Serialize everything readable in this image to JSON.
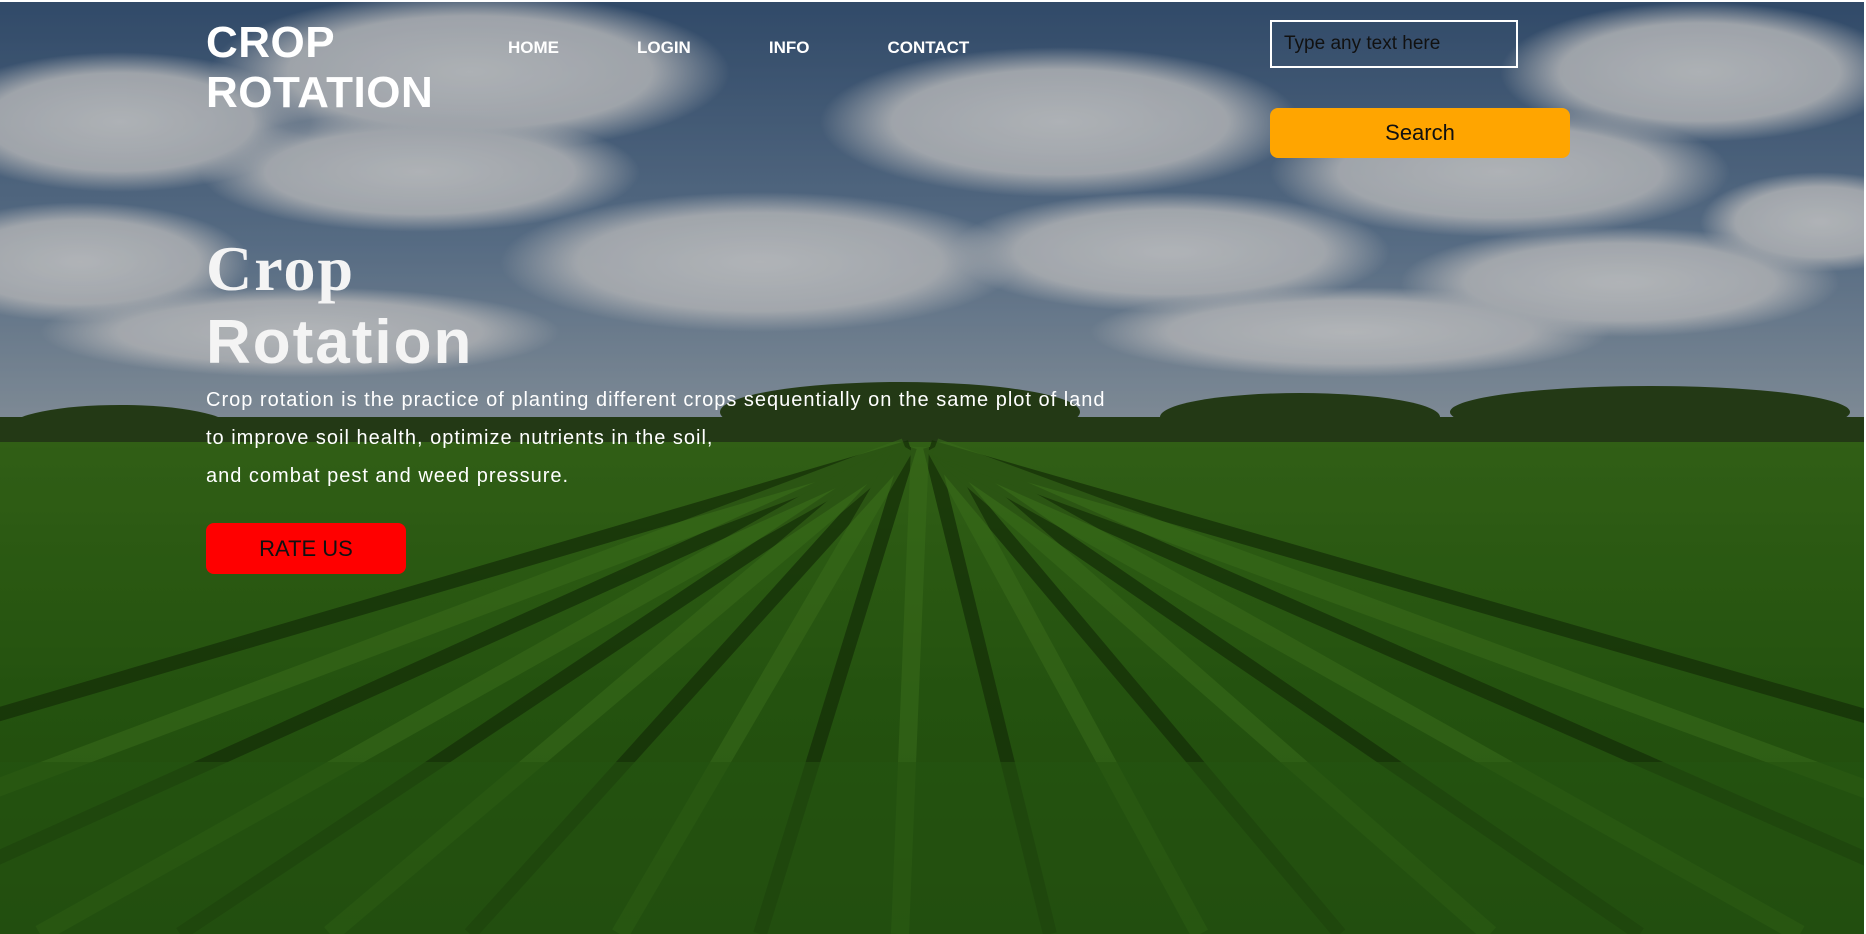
{
  "brand": {
    "line1": "CROP",
    "line2": "ROTATION"
  },
  "nav": {
    "items": [
      {
        "label": "HOME"
      },
      {
        "label": "LOGIN"
      },
      {
        "label": "INFO"
      },
      {
        "label": "CONTACT"
      }
    ]
  },
  "search": {
    "placeholder": "Type any text here",
    "value": "",
    "button_label": "Search"
  },
  "hero": {
    "title_line1": "Crop",
    "title_line2": "Rotation",
    "description_lines": [
      "Crop rotation is the practice of planting different crops sequentially on the same plot of land",
      "to improve soil health, optimize nutrients in the soil,",
      "and combat pest and weed pressure."
    ],
    "cta_label": "RATE US",
    "background_image": "crop-field-photo"
  },
  "colors": {
    "search_button": "#ffa500",
    "rate_button": "#ff0000",
    "text": "#ffffff"
  }
}
